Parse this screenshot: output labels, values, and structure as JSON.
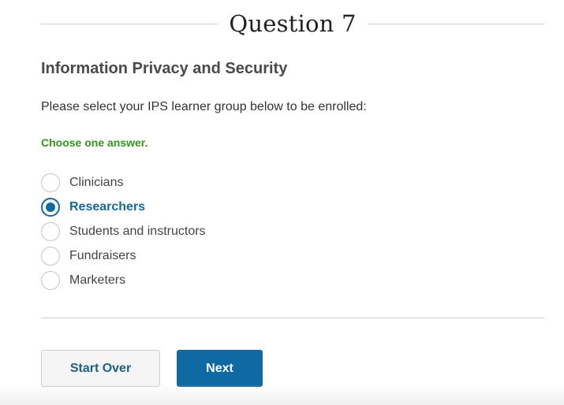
{
  "header": {
    "question_title": "Question 7"
  },
  "question": {
    "section_title": "Information Privacy and Security",
    "prompt": "Please select your IPS learner group below to be enrolled:",
    "hint": "Choose one answer.",
    "options": [
      {
        "label": "Clinicians",
        "selected": false
      },
      {
        "label": "Researchers",
        "selected": true
      },
      {
        "label": "Students and instructors",
        "selected": false
      },
      {
        "label": "Fundraisers",
        "selected": false
      },
      {
        "label": "Marketers",
        "selected": false
      }
    ]
  },
  "actions": {
    "start_over_label": "Start Over",
    "next_label": "Next"
  },
  "colors": {
    "accent": "#0f6aa3",
    "hint_green": "#2e9a1a",
    "divider": "#cccccc"
  }
}
